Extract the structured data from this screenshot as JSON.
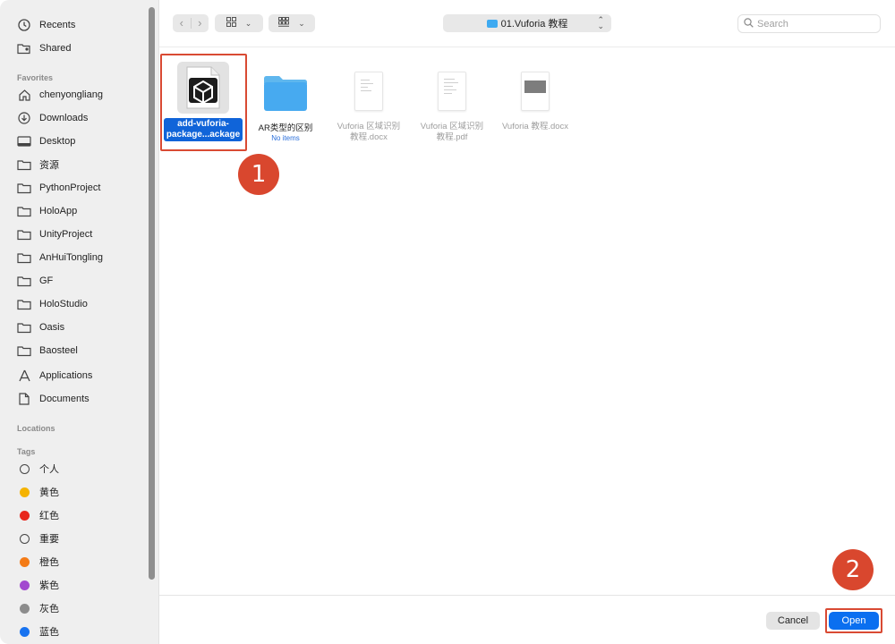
{
  "sidebar": {
    "top": [
      {
        "label": "Recents",
        "icon": "clock-icon"
      },
      {
        "label": "Shared",
        "icon": "shared-folder-icon"
      }
    ],
    "favorites_header": "Favorites",
    "favorites": [
      {
        "label": "chenyongliang",
        "icon": "home-icon"
      },
      {
        "label": "Downloads",
        "icon": "download-icon"
      },
      {
        "label": "Desktop",
        "icon": "desktop-icon"
      },
      {
        "label": "资源",
        "icon": "folder-icon"
      },
      {
        "label": "PythonProject",
        "icon": "folder-icon"
      },
      {
        "label": "HoloApp",
        "icon": "folder-icon"
      },
      {
        "label": "UnityProject",
        "icon": "folder-icon"
      },
      {
        "label": "AnHuiTongling",
        "icon": "folder-icon"
      },
      {
        "label": "GF",
        "icon": "folder-icon"
      },
      {
        "label": "HoloStudio",
        "icon": "folder-icon"
      },
      {
        "label": "Oasis",
        "icon": "folder-icon"
      },
      {
        "label": "Baosteel",
        "icon": "folder-icon"
      },
      {
        "label": "Applications",
        "icon": "applications-icon"
      },
      {
        "label": "Documents",
        "icon": "document-icon"
      }
    ],
    "locations_header": "Locations",
    "tags_header": "Tags",
    "tags": [
      {
        "label": "个人",
        "color": "none"
      },
      {
        "label": "黄色",
        "color": "#f5b300"
      },
      {
        "label": "红色",
        "color": "#e8261c"
      },
      {
        "label": "重要",
        "color": "none"
      },
      {
        "label": "橙色",
        "color": "#f47b16"
      },
      {
        "label": "紫色",
        "color": "#a249cf"
      },
      {
        "label": "灰色",
        "color": "#8c8c8c"
      },
      {
        "label": "蓝色",
        "color": "#1873f0"
      }
    ]
  },
  "toolbar": {
    "location": "01.Vuforia 教程",
    "search_placeholder": "Search"
  },
  "files": [
    {
      "name_line1": "add-vuforia-",
      "name_line2": "package...ackage",
      "type": "unitypackage",
      "selected": true
    },
    {
      "name": "AR类型的区别",
      "sub": "No items",
      "type": "folder"
    },
    {
      "name_line1": "Vuforia 区域识别",
      "name_line2": "教程.docx",
      "type": "docx"
    },
    {
      "name_line1": "Vuforia 区域识别",
      "name_line2": "教程.pdf",
      "type": "pdf"
    },
    {
      "name": "Vuforia 教程.docx",
      "type": "docx-image"
    }
  ],
  "annotations": {
    "step1": "1",
    "step2": "2",
    "color": "#d9472e"
  },
  "buttons": {
    "cancel": "Cancel",
    "open": "Open"
  }
}
